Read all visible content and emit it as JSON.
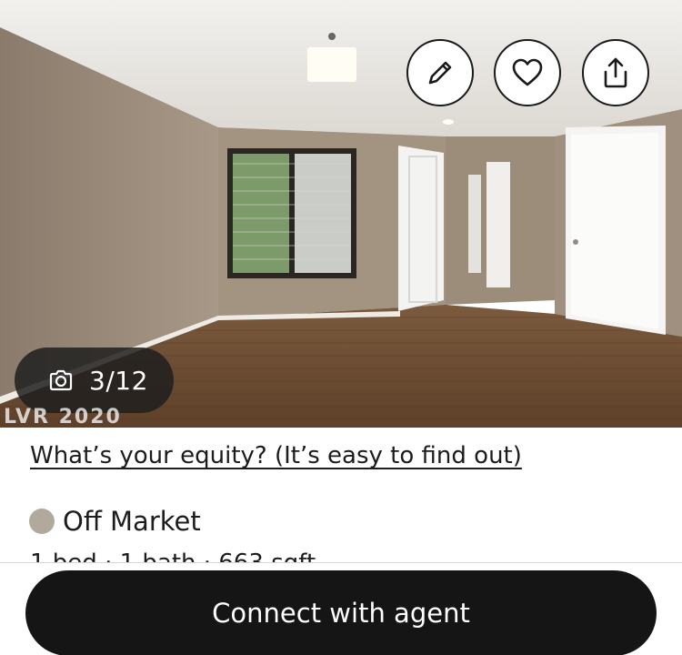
{
  "photo": {
    "counter": "3/12",
    "watermark": "LVR 2020",
    "actions": {
      "edit_icon": "pencil-icon",
      "favorite_icon": "heart-icon",
      "share_icon": "share-icon"
    }
  },
  "listing": {
    "equity_link": "What’s your equity? (It’s easy to find out)",
    "status": "Off Market",
    "status_color": "#b1a99c",
    "facts": "1 bed · 1 bath · 663 sqft"
  },
  "cta": {
    "label": "Connect with agent"
  },
  "colors": {
    "cta_background": "#151515",
    "text": "#1c1c1c"
  }
}
